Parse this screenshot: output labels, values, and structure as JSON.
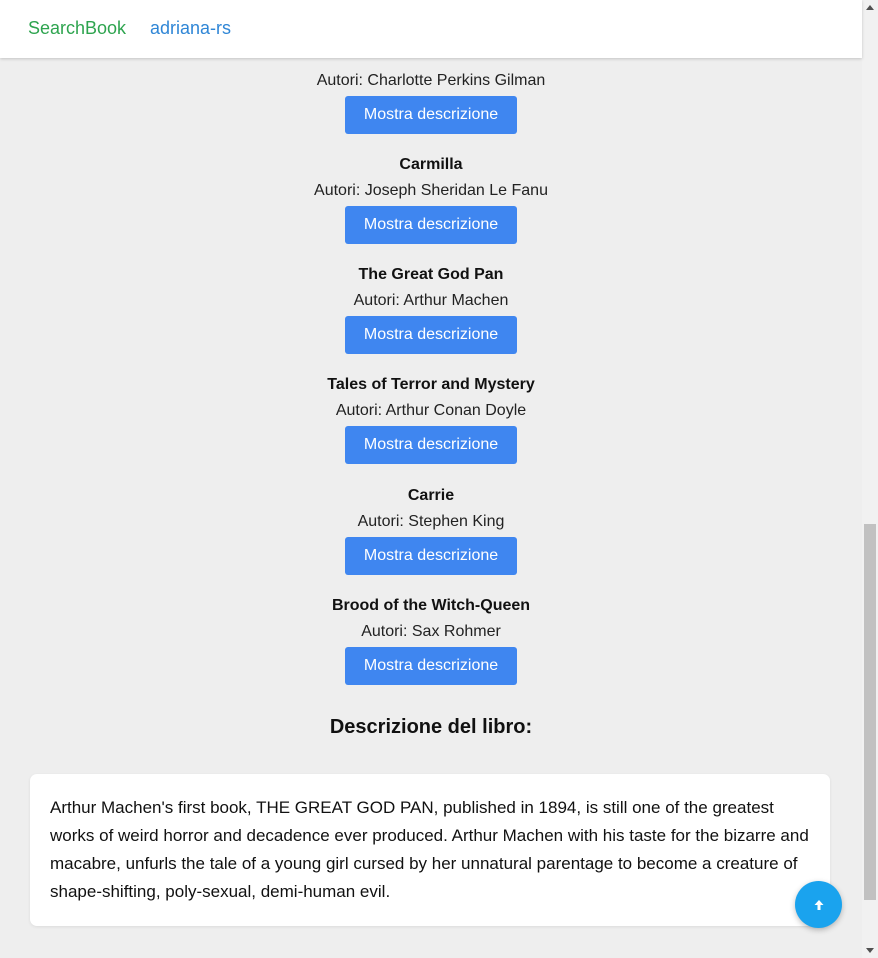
{
  "navbar": {
    "brand": "SearchBook",
    "user": "adriana-rs"
  },
  "books": [
    {
      "title": "",
      "author": "Autori: Charlotte Perkins Gilman",
      "button": "Mostra descrizione"
    },
    {
      "title": "Carmilla",
      "author": "Autori: Joseph Sheridan Le Fanu",
      "button": "Mostra descrizione"
    },
    {
      "title": "The Great God Pan",
      "author": "Autori: Arthur Machen",
      "button": "Mostra descrizione"
    },
    {
      "title": "Tales of Terror and Mystery",
      "author": "Autori: Arthur Conan Doyle",
      "button": "Mostra descrizione"
    },
    {
      "title": "Carrie",
      "author": "Autori: Stephen King",
      "button": "Mostra descrizione"
    },
    {
      "title": "Brood of the Witch-Queen",
      "author": "Autori: Sax Rohmer",
      "button": "Mostra descrizione"
    }
  ],
  "description": {
    "heading": "Descrizione del libro:",
    "text": "Arthur Machen's first book, THE GREAT GOD PAN, published in 1894, is still one of the greatest works of weird horror and decadence ever produced. Arthur Machen with his taste for the bizarre and macabre, unfurls the tale of a young girl cursed by her unnatural parentage to become a creature of shape-shifting, poly-sexual, demi-human evil."
  },
  "scroll_top_button": {
    "icon": "arrow-up-icon"
  },
  "colors": {
    "brand": "#2ea44f",
    "user_link": "#2f86d6",
    "button": "#3f86f0",
    "fab": "#1aa3ee",
    "background": "#eeeeee"
  }
}
